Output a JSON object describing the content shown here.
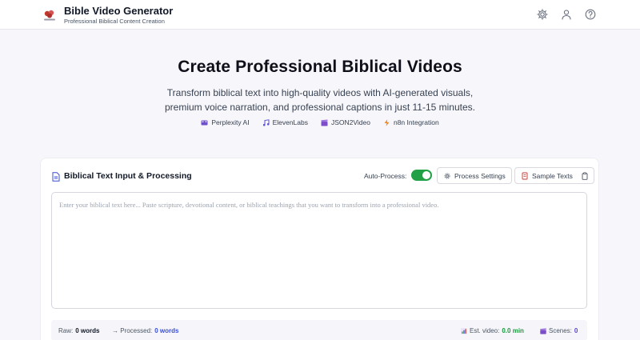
{
  "header": {
    "title": "Bible Video Generator",
    "subtitle": "Professional Biblical Content Creation",
    "icons": [
      "gear-icon",
      "user-icon",
      "help-icon"
    ]
  },
  "hero": {
    "title": "Create Professional Biblical Videos",
    "description_line1": "Transform biblical text into high-quality videos with AI-generated visuals,",
    "description_line2": "premium voice narration, and professional captions in just 11-15 minutes.",
    "technologies": [
      {
        "label": "Perplexity AI",
        "icon": "film-icon"
      },
      {
        "label": "ElevenLabs",
        "icon": "music-note-icon"
      },
      {
        "label": "JSON2Video",
        "icon": "clapper-icon"
      },
      {
        "label": "n8n Integration",
        "icon": "lightning-icon"
      }
    ]
  },
  "input_card": {
    "title": "Biblical Text Input & Processing",
    "auto_process_label": "Auto-Process:",
    "auto_process_on": true,
    "process_settings_label": "Process Settings",
    "sample_texts_label": "Sample Texts",
    "textarea_value": "",
    "textarea_placeholder": "Enter your biblical text here... Paste scripture, devotional content, or biblical teachings that you want to transform into a professional video."
  },
  "stats": {
    "raw_label": "Raw:",
    "raw_value": "0 words",
    "processed_label": "→ Processed:",
    "processed_value": "0 words",
    "est_video_label": "Est. video:",
    "est_video_value": "0.0 min",
    "scenes_label": "Scenes:",
    "scenes_value": "0"
  },
  "colors": {
    "accent_blue": "#3b4fd6",
    "toggle_green": "#22a046",
    "logo_red": "#c0392b"
  }
}
